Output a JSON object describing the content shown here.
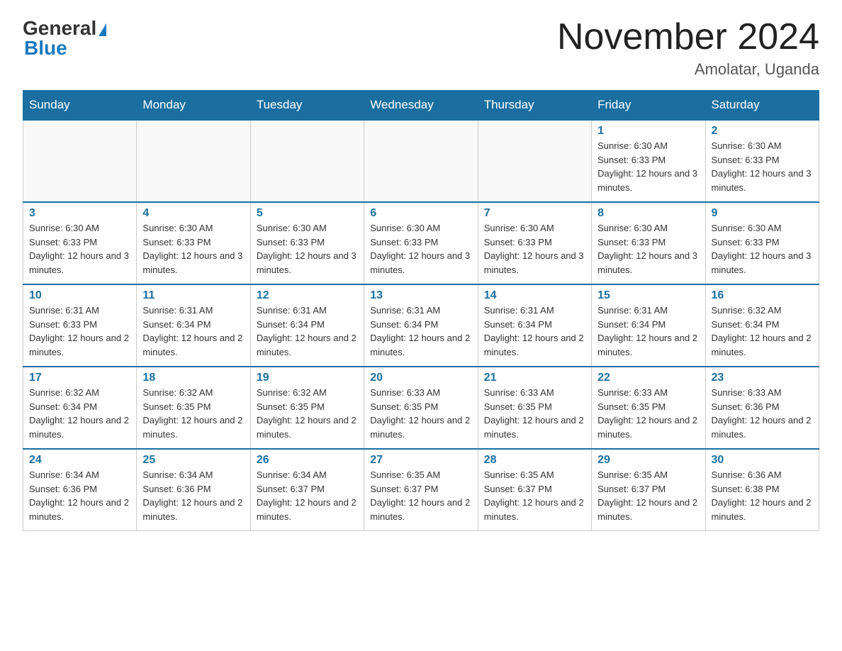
{
  "header": {
    "logo_general": "General",
    "logo_blue": "Blue",
    "month_title": "November 2024",
    "location": "Amolatar, Uganda"
  },
  "days_of_week": [
    "Sunday",
    "Monday",
    "Tuesday",
    "Wednesday",
    "Thursday",
    "Friday",
    "Saturday"
  ],
  "weeks": [
    [
      {
        "day": "",
        "info": ""
      },
      {
        "day": "",
        "info": ""
      },
      {
        "day": "",
        "info": ""
      },
      {
        "day": "",
        "info": ""
      },
      {
        "day": "",
        "info": ""
      },
      {
        "day": "1",
        "info": "Sunrise: 6:30 AM\nSunset: 6:33 PM\nDaylight: 12 hours and 3 minutes."
      },
      {
        "day": "2",
        "info": "Sunrise: 6:30 AM\nSunset: 6:33 PM\nDaylight: 12 hours and 3 minutes."
      }
    ],
    [
      {
        "day": "3",
        "info": "Sunrise: 6:30 AM\nSunset: 6:33 PM\nDaylight: 12 hours and 3 minutes."
      },
      {
        "day": "4",
        "info": "Sunrise: 6:30 AM\nSunset: 6:33 PM\nDaylight: 12 hours and 3 minutes."
      },
      {
        "day": "5",
        "info": "Sunrise: 6:30 AM\nSunset: 6:33 PM\nDaylight: 12 hours and 3 minutes."
      },
      {
        "day": "6",
        "info": "Sunrise: 6:30 AM\nSunset: 6:33 PM\nDaylight: 12 hours and 3 minutes."
      },
      {
        "day": "7",
        "info": "Sunrise: 6:30 AM\nSunset: 6:33 PM\nDaylight: 12 hours and 3 minutes."
      },
      {
        "day": "8",
        "info": "Sunrise: 6:30 AM\nSunset: 6:33 PM\nDaylight: 12 hours and 3 minutes."
      },
      {
        "day": "9",
        "info": "Sunrise: 6:30 AM\nSunset: 6:33 PM\nDaylight: 12 hours and 3 minutes."
      }
    ],
    [
      {
        "day": "10",
        "info": "Sunrise: 6:31 AM\nSunset: 6:33 PM\nDaylight: 12 hours and 2 minutes."
      },
      {
        "day": "11",
        "info": "Sunrise: 6:31 AM\nSunset: 6:34 PM\nDaylight: 12 hours and 2 minutes."
      },
      {
        "day": "12",
        "info": "Sunrise: 6:31 AM\nSunset: 6:34 PM\nDaylight: 12 hours and 2 minutes."
      },
      {
        "day": "13",
        "info": "Sunrise: 6:31 AM\nSunset: 6:34 PM\nDaylight: 12 hours and 2 minutes."
      },
      {
        "day": "14",
        "info": "Sunrise: 6:31 AM\nSunset: 6:34 PM\nDaylight: 12 hours and 2 minutes."
      },
      {
        "day": "15",
        "info": "Sunrise: 6:31 AM\nSunset: 6:34 PM\nDaylight: 12 hours and 2 minutes."
      },
      {
        "day": "16",
        "info": "Sunrise: 6:32 AM\nSunset: 6:34 PM\nDaylight: 12 hours and 2 minutes."
      }
    ],
    [
      {
        "day": "17",
        "info": "Sunrise: 6:32 AM\nSunset: 6:34 PM\nDaylight: 12 hours and 2 minutes."
      },
      {
        "day": "18",
        "info": "Sunrise: 6:32 AM\nSunset: 6:35 PM\nDaylight: 12 hours and 2 minutes."
      },
      {
        "day": "19",
        "info": "Sunrise: 6:32 AM\nSunset: 6:35 PM\nDaylight: 12 hours and 2 minutes."
      },
      {
        "day": "20",
        "info": "Sunrise: 6:33 AM\nSunset: 6:35 PM\nDaylight: 12 hours and 2 minutes."
      },
      {
        "day": "21",
        "info": "Sunrise: 6:33 AM\nSunset: 6:35 PM\nDaylight: 12 hours and 2 minutes."
      },
      {
        "day": "22",
        "info": "Sunrise: 6:33 AM\nSunset: 6:35 PM\nDaylight: 12 hours and 2 minutes."
      },
      {
        "day": "23",
        "info": "Sunrise: 6:33 AM\nSunset: 6:36 PM\nDaylight: 12 hours and 2 minutes."
      }
    ],
    [
      {
        "day": "24",
        "info": "Sunrise: 6:34 AM\nSunset: 6:36 PM\nDaylight: 12 hours and 2 minutes."
      },
      {
        "day": "25",
        "info": "Sunrise: 6:34 AM\nSunset: 6:36 PM\nDaylight: 12 hours and 2 minutes."
      },
      {
        "day": "26",
        "info": "Sunrise: 6:34 AM\nSunset: 6:37 PM\nDaylight: 12 hours and 2 minutes."
      },
      {
        "day": "27",
        "info": "Sunrise: 6:35 AM\nSunset: 6:37 PM\nDaylight: 12 hours and 2 minutes."
      },
      {
        "day": "28",
        "info": "Sunrise: 6:35 AM\nSunset: 6:37 PM\nDaylight: 12 hours and 2 minutes."
      },
      {
        "day": "29",
        "info": "Sunrise: 6:35 AM\nSunset: 6:37 PM\nDaylight: 12 hours and 2 minutes."
      },
      {
        "day": "30",
        "info": "Sunrise: 6:36 AM\nSunset: 6:38 PM\nDaylight: 12 hours and 2 minutes."
      }
    ]
  ]
}
